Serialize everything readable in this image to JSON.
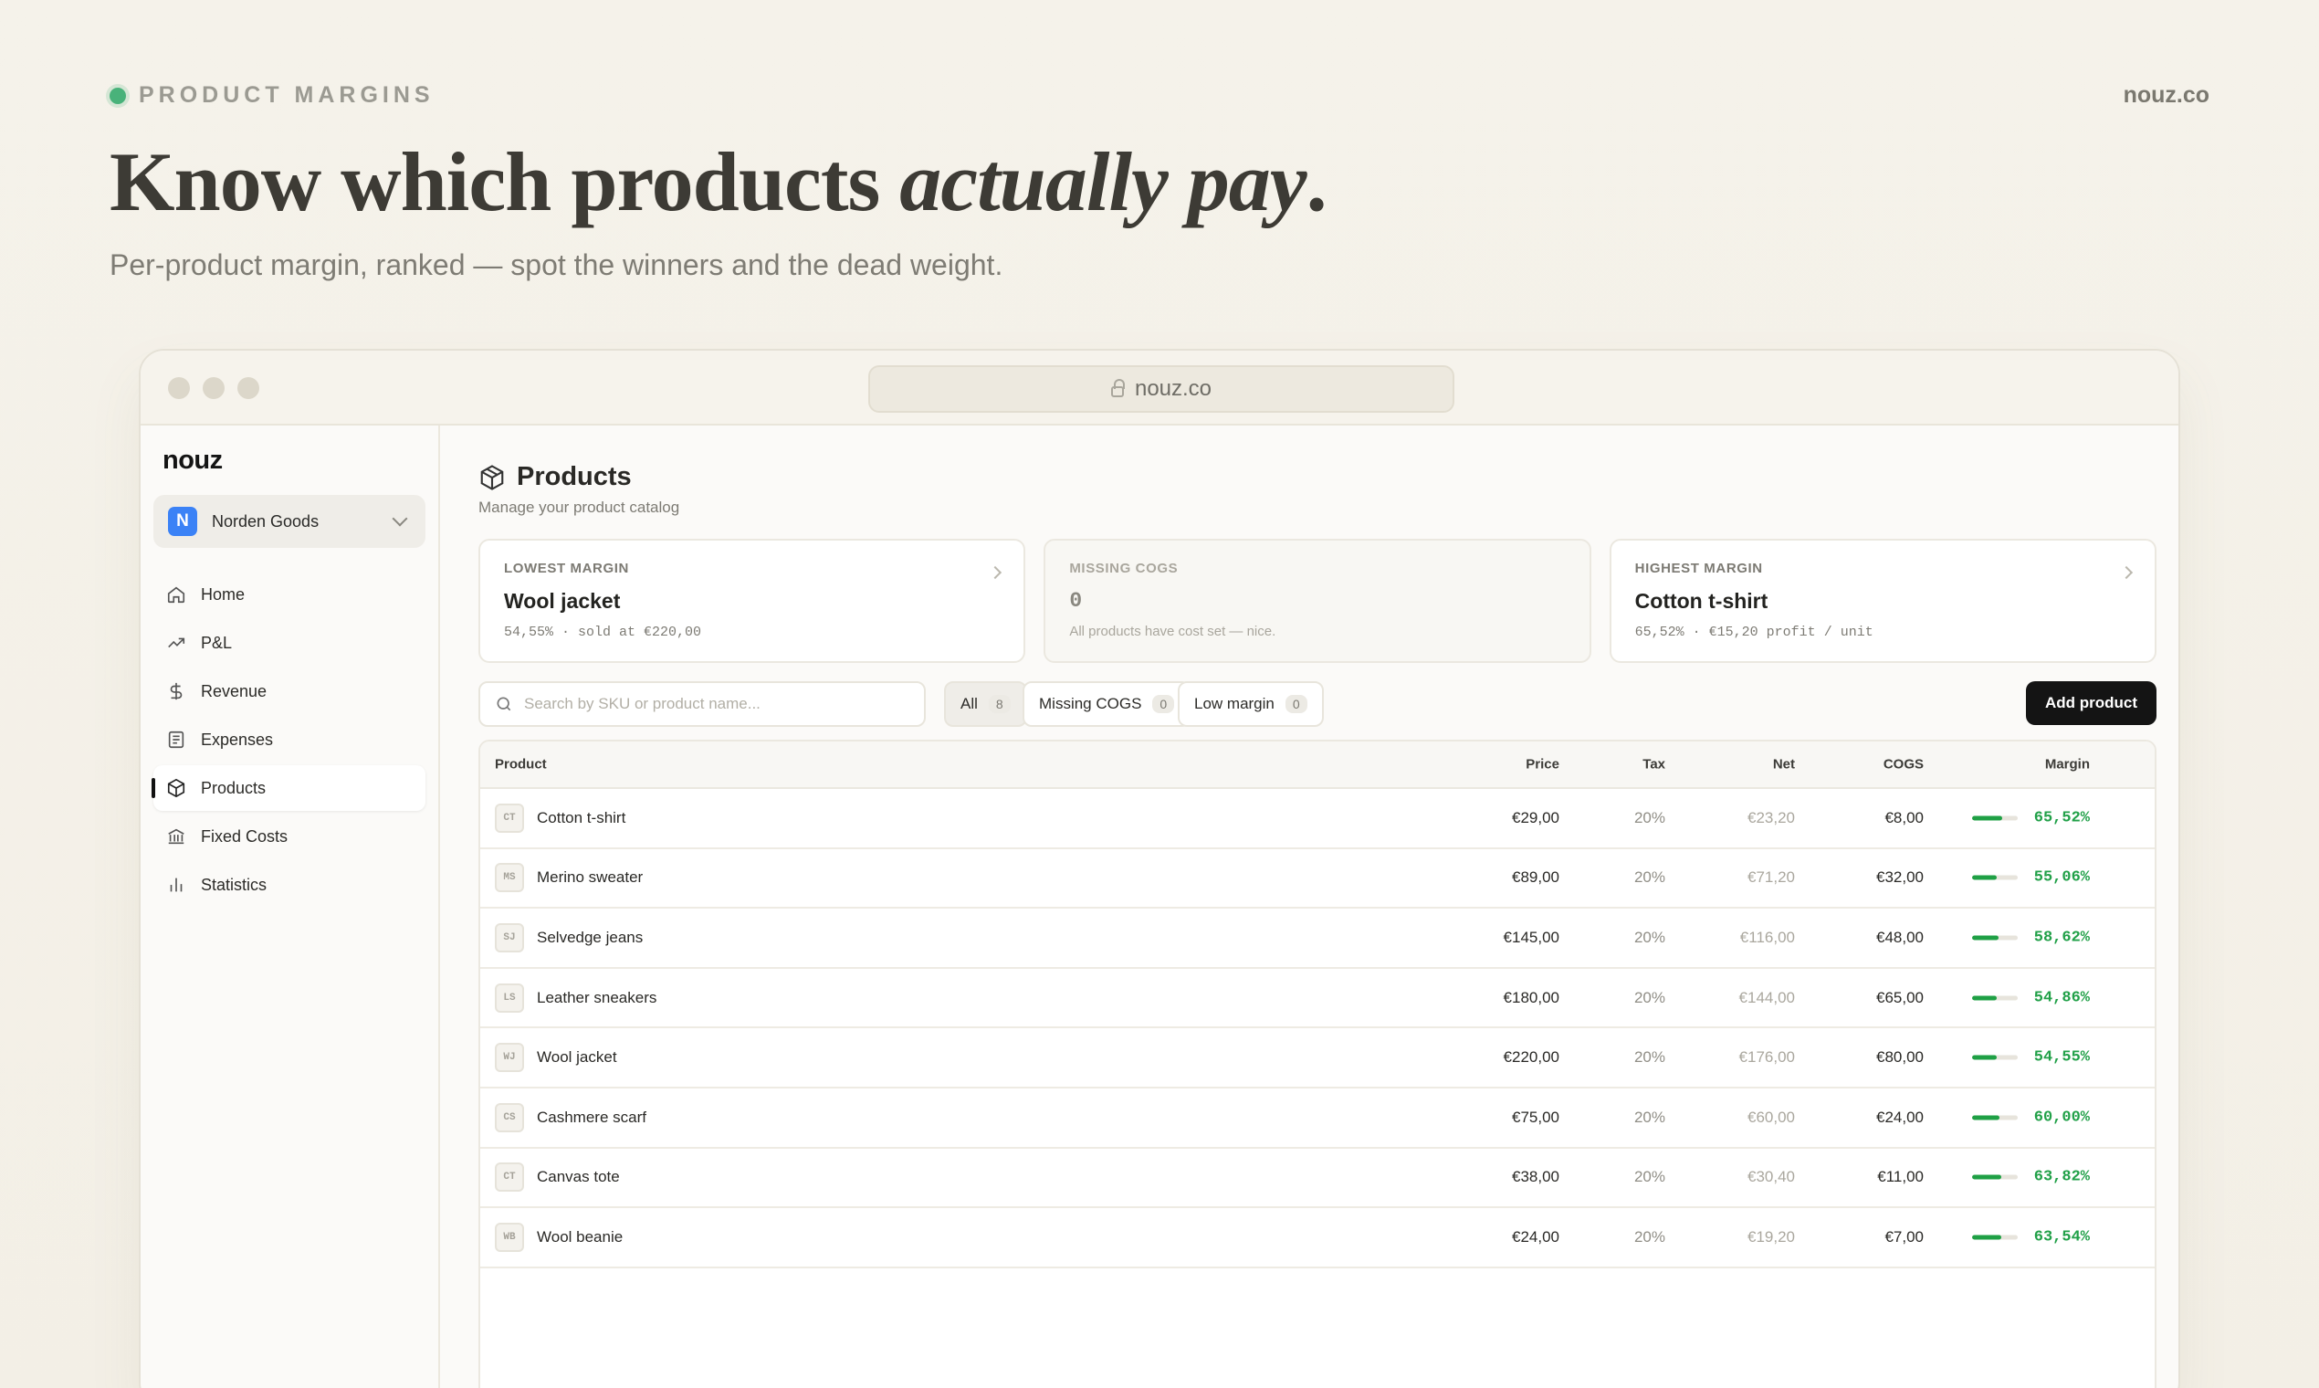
{
  "hero": {
    "eyebrow": "PRODUCT MARGINS",
    "site": "nouz.co",
    "headline_plain": "Know which products ",
    "headline_italic": "actually pay",
    "headline_end": ".",
    "subhead": "Per-product margin, ranked — spot the winners and the dead weight."
  },
  "browser": {
    "url": "nouz.co"
  },
  "sidebar": {
    "logo": "nouz",
    "workspace": {
      "badge": "N",
      "name": "Norden Goods"
    },
    "items": [
      {
        "label": "Home",
        "icon": "home-icon"
      },
      {
        "label": "P&L",
        "icon": "trend-up-icon"
      },
      {
        "label": "Revenue",
        "icon": "dollar-icon"
      },
      {
        "label": "Expenses",
        "icon": "receipt-icon"
      },
      {
        "label": "Products",
        "icon": "box-icon",
        "active": true
      },
      {
        "label": "Fixed Costs",
        "icon": "bank-icon"
      },
      {
        "label": "Statistics",
        "icon": "bar-chart-icon"
      }
    ]
  },
  "page": {
    "title": "Products",
    "subtitle": "Manage your product catalog"
  },
  "cards": [
    {
      "label": "LOWEST MARGIN",
      "value": "Wool jacket",
      "meta": "54,55% · sold at €220,00"
    },
    {
      "label": "MISSING COGS",
      "value": "0",
      "meta": "All products have cost set — nice."
    },
    {
      "label": "HIGHEST MARGIN",
      "value": "Cotton t-shirt",
      "meta": "65,52% · €15,20 profit / unit"
    }
  ],
  "toolbar": {
    "search_placeholder": "Search by SKU or product name...",
    "filters": [
      {
        "label": "All",
        "count": "8"
      },
      {
        "label": "Missing COGS",
        "count": "0"
      },
      {
        "label": "Low margin",
        "count": "0"
      }
    ],
    "add_label": "Add product"
  },
  "table": {
    "headers": {
      "product": "Product",
      "price": "Price",
      "tax": "Tax",
      "net": "Net",
      "cogs": "COGS",
      "margin": "Margin"
    },
    "rows": [
      {
        "abbr": "CT",
        "name": "Cotton t-shirt",
        "price": "€29,00",
        "tax": "20%",
        "net": "€23,20",
        "cogs": "€8,00",
        "margin": "65,52%",
        "margin_pct": 65.52
      },
      {
        "abbr": "MS",
        "name": "Merino sweater",
        "price": "€89,00",
        "tax": "20%",
        "net": "€71,20",
        "cogs": "€32,00",
        "margin": "55,06%",
        "margin_pct": 55.06
      },
      {
        "abbr": "SJ",
        "name": "Selvedge jeans",
        "price": "€145,00",
        "tax": "20%",
        "net": "€116,00",
        "cogs": "€48,00",
        "margin": "58,62%",
        "margin_pct": 58.62
      },
      {
        "abbr": "LS",
        "name": "Leather sneakers",
        "price": "€180,00",
        "tax": "20%",
        "net": "€144,00",
        "cogs": "€65,00",
        "margin": "54,86%",
        "margin_pct": 54.86
      },
      {
        "abbr": "WJ",
        "name": "Wool jacket",
        "price": "€220,00",
        "tax": "20%",
        "net": "€176,00",
        "cogs": "€80,00",
        "margin": "54,55%",
        "margin_pct": 54.55
      },
      {
        "abbr": "CS",
        "name": "Cashmere scarf",
        "price": "€75,00",
        "tax": "20%",
        "net": "€60,00",
        "cogs": "€24,00",
        "margin": "60,00%",
        "margin_pct": 60.0
      },
      {
        "abbr": "CT",
        "name": "Canvas tote",
        "price": "€38,00",
        "tax": "20%",
        "net": "€30,40",
        "cogs": "€11,00",
        "margin": "63,82%",
        "margin_pct": 63.82
      },
      {
        "abbr": "WB",
        "name": "Wool beanie",
        "price": "€24,00",
        "tax": "20%",
        "net": "€19,20",
        "cogs": "€7,00",
        "margin": "63,54%",
        "margin_pct": 63.54
      }
    ]
  },
  "colors": {
    "accent_green": "#1fa045",
    "workspace_blue": "#3b82f6",
    "status_dot": "#49b27a"
  }
}
